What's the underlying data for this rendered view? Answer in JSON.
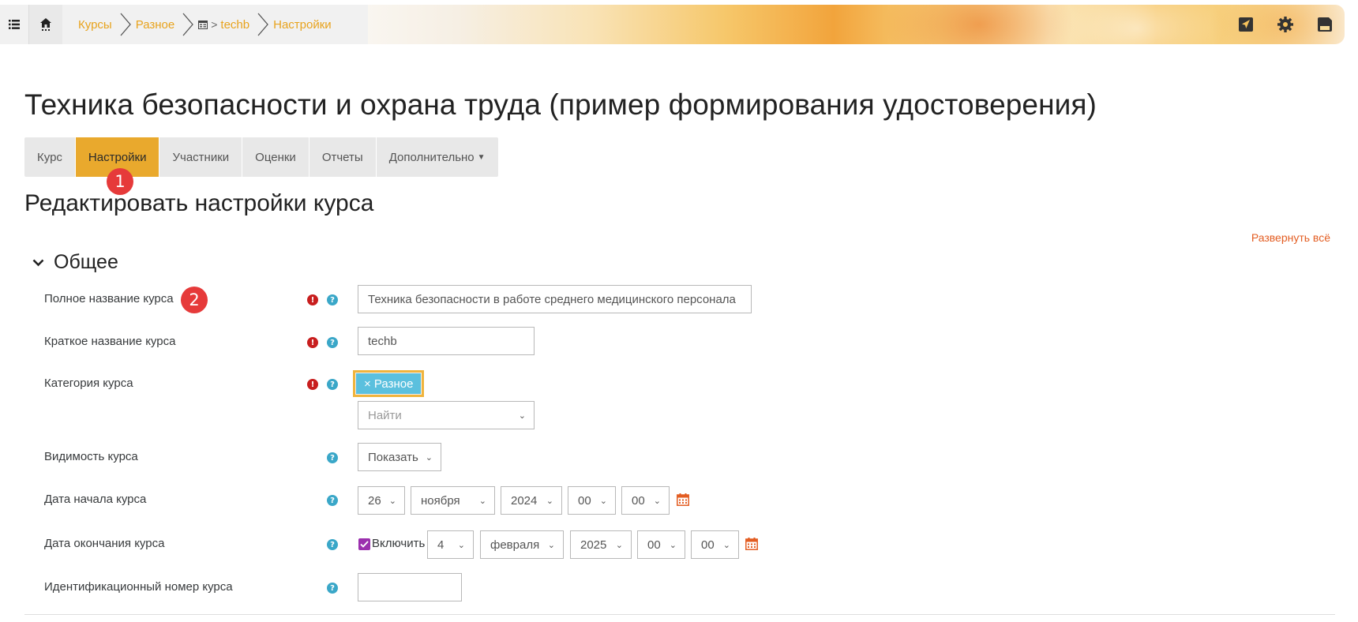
{
  "breadcrumb": {
    "items": [
      "Курсы",
      "Разное",
      "techb",
      "Настройки"
    ]
  },
  "course_title": "Техника безопасности и охрана труда (пример формирования удостоверения)",
  "tabs": [
    {
      "label": "Курс",
      "active": false
    },
    {
      "label": "Настройки",
      "active": true
    },
    {
      "label": "Участники",
      "active": false
    },
    {
      "label": "Оценки",
      "active": false
    },
    {
      "label": "Отчеты",
      "active": false
    },
    {
      "label": "Дополнительно",
      "active": false
    }
  ],
  "badges": [
    "1",
    "2"
  ],
  "page_heading": "Редактировать настройки курса",
  "expand_all": "Развернуть всё",
  "section": {
    "title": "Общее"
  },
  "form": {
    "fullname": {
      "label": "Полное название курса",
      "value": "Техника безопасности в работе среднего медицинского персонала"
    },
    "shortname": {
      "label": "Краткое название курса",
      "value": "techb"
    },
    "category": {
      "label": "Категория курса",
      "chip": "× Разное",
      "search_placeholder": "Найти"
    },
    "visibility": {
      "label": "Видимость курса",
      "value": "Показать"
    },
    "startdate": {
      "label": "Дата начала курса",
      "day": "26",
      "month": "ноября",
      "year": "2024",
      "hour": "00",
      "minute": "00"
    },
    "enddate": {
      "label": "Дата окончания курса",
      "enable_label": "Включить",
      "enabled": true,
      "day": "4",
      "month": "февраля",
      "year": "2025",
      "hour": "00",
      "minute": "00"
    },
    "idnumber": {
      "label": "Идентификационный номер курса",
      "value": ""
    }
  },
  "colors": {
    "accent": "#e9a92d",
    "link": "#e35d22",
    "required": "#c81e1e",
    "help": "#3aa7c8",
    "chip": "#5bc0de",
    "checkbox": "#9b2fae",
    "badge": "#e63a3a"
  },
  "icons": [
    "menu-icon",
    "home-icon",
    "chevron-right-icon",
    "course-icon",
    "send-icon",
    "gear-icon",
    "save-icon",
    "chevron-down-icon",
    "required-icon",
    "help-icon",
    "calendar-icon",
    "check-icon"
  ]
}
